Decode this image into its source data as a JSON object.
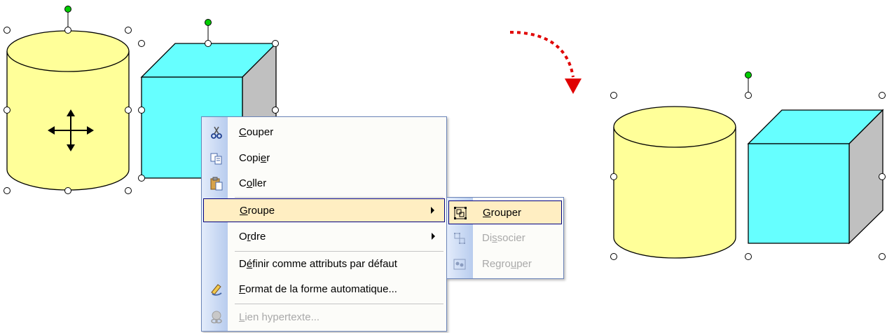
{
  "context_menu": {
    "items": [
      {
        "pre": "",
        "acc": "C",
        "post": "ouper",
        "icon": "scissors-icon"
      },
      {
        "pre": "Copi",
        "acc": "e",
        "post": "r",
        "icon": "copy-icon"
      },
      {
        "pre": "C",
        "acc": "o",
        "post": "ller",
        "icon": "paste-icon"
      },
      {
        "pre": "",
        "acc": "G",
        "post": "roupe",
        "icon": ""
      },
      {
        "pre": "O",
        "acc": "r",
        "post": "dre",
        "icon": ""
      },
      {
        "pre": "D",
        "acc": "é",
        "post": "finir comme attributs par défaut",
        "icon": ""
      },
      {
        "pre": "",
        "acc": "F",
        "post": "ormat de la forme automatique...",
        "icon": "format-autoshape-icon"
      },
      {
        "pre": "",
        "acc": "L",
        "post": "ien hypertexte...",
        "icon": "hyperlink-icon"
      }
    ]
  },
  "submenu": {
    "items": [
      {
        "pre": "",
        "acc": "G",
        "post": "rouper",
        "icon": "group-icon"
      },
      {
        "pre": "Di",
        "acc": "s",
        "post": "socier",
        "icon": "ungroup-icon"
      },
      {
        "pre": "Regro",
        "acc": "u",
        "post": "per",
        "icon": "regroup-icon"
      }
    ]
  },
  "colors": {
    "cylinder_fill": "#ffff99",
    "cube_front": "#66ffff",
    "cube_side": "#c0c0c0",
    "highlight": "#ffeec2",
    "arrow": "#e00000",
    "handle_green": "#00cc00"
  }
}
